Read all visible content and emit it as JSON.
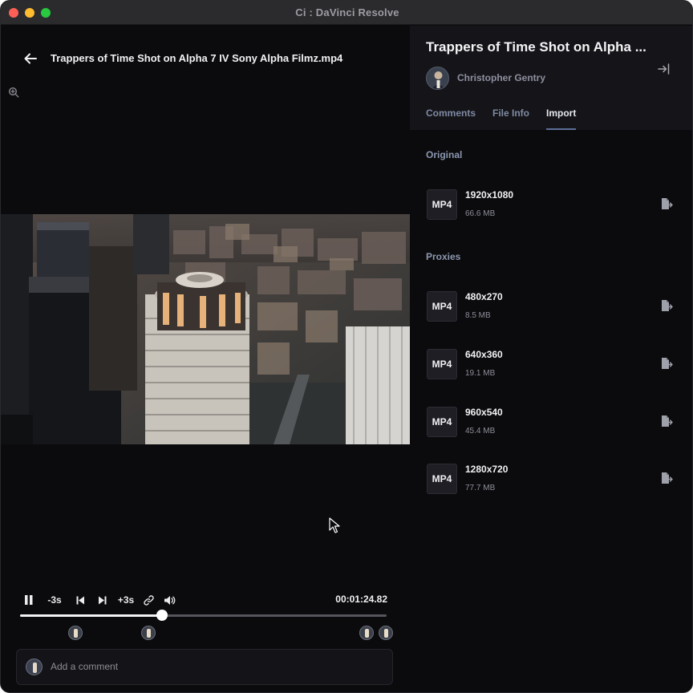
{
  "window": {
    "title": "Ci : DaVinci Resolve"
  },
  "player": {
    "file_title": "Trappers of Time Shot on Alpha 7 IV Sony Alpha Filmz.mp4",
    "controls": {
      "back_label": "-3s",
      "forward_label": "+3s"
    },
    "timecode": "00:01:24.82",
    "progress_fraction": 0.388,
    "comment_markers": [
      0.15,
      0.35,
      0.945,
      0.997
    ],
    "comment_placeholder": "Add a comment"
  },
  "panel": {
    "title": "Trappers of Time Shot on Alpha ...",
    "author": "Christopher Gentry",
    "tabs": [
      {
        "label": "Comments",
        "active": false
      },
      {
        "label": "File Info",
        "active": false
      },
      {
        "label": "Import",
        "active": true
      }
    ],
    "original_label": "Original",
    "original": {
      "badge": "MP4",
      "resolution": "1920x1080",
      "size": "66.6 MB"
    },
    "proxies_label": "Proxies",
    "proxies": [
      {
        "badge": "MP4",
        "resolution": "480x270",
        "size": "8.5 MB"
      },
      {
        "badge": "MP4",
        "resolution": "640x360",
        "size": "19.1 MB"
      },
      {
        "badge": "MP4",
        "resolution": "960x540",
        "size": "45.4 MB"
      },
      {
        "badge": "MP4",
        "resolution": "1280x720",
        "size": "77.7 MB"
      }
    ]
  },
  "colors": {
    "background": "#0b0b0d",
    "panel_header": "#151519",
    "accent_tab": "#5d6f97",
    "muted_text": "#8c97b0"
  }
}
